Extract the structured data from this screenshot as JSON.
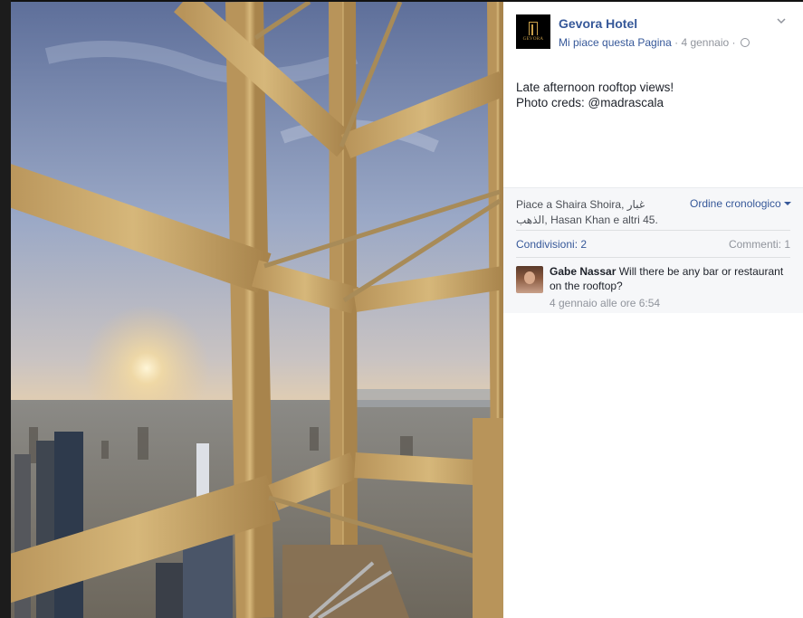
{
  "post": {
    "page_name": "Gevora Hotel",
    "logo_text": "GEVORA",
    "like_page": "Mi piace questa Pagina",
    "separator": "·",
    "date": "4 gennaio",
    "text_line1": "Late afternoon rooftop views!",
    "text_line2": "Photo creds: @madrascala"
  },
  "reactions": {
    "likes_text": "Piace a Shaira Shoira, غبار الذهب, Hasan Khan e altri 45.",
    "sort_label": "Ordine cronologico",
    "shares": "Condivisioni: 2",
    "comments": "Commenti: 1"
  },
  "comment": {
    "author": "Gabe Nassar",
    "text": "Will there be any bar or restaurant on the rooftop?",
    "time": "4 gennaio alle ore 6:54"
  },
  "icons": {
    "chevron": "chevron-down-icon",
    "globe": "globe-icon",
    "caret": "caret-down-icon"
  },
  "colors": {
    "link": "#365899",
    "muted": "#90949c",
    "text": "#1d2129"
  }
}
